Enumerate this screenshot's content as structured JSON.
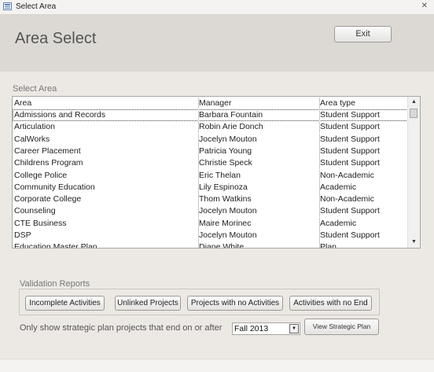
{
  "window": {
    "title": "Select Area",
    "close_glyph": "✕"
  },
  "header": {
    "title": "Area Select",
    "exit_label": "Exit"
  },
  "list": {
    "section_label": "Select Area",
    "columns": [
      "Area",
      "Manager",
      "Area type"
    ],
    "rows": [
      [
        "Admissions and Records",
        "Barbara Fountain",
        "Student Support"
      ],
      [
        "Articulation",
        "Robin Arie Donch",
        "Student Support"
      ],
      [
        "CalWorks",
        "Jocelyn Mouton",
        "Student Support"
      ],
      [
        "Career Placement",
        "Patricia Young",
        "Student Support"
      ],
      [
        "Childrens Program",
        "Christie Speck",
        "Student Support"
      ],
      [
        "College Police",
        "Eric Thelan",
        "Non-Academic"
      ],
      [
        "Community Education",
        "Lily Espinoza",
        "Academic"
      ],
      [
        "Corporate College",
        "Thom Watkins",
        "Non-Academic"
      ],
      [
        "Counseling",
        "Jocelyn Mouton",
        "Student Support"
      ],
      [
        "CTE Business",
        "Maire Morinec",
        "Academic"
      ],
      [
        "DSP",
        "Jocelyn Mouton",
        "Student Support"
      ],
      [
        "Education Master Plan",
        "Diane White",
        "Plan"
      ]
    ]
  },
  "validation": {
    "label": "Validation Reports",
    "buttons": {
      "incomplete": "Incomplete Activities",
      "unlinked": "Unlinked Projects",
      "no_activities": "Projects with no Activities",
      "no_end": "Activities with no End"
    }
  },
  "filter": {
    "label": "Only show strategic plan projects that end on or after",
    "selected": "Fall 2013",
    "view_label": "View Strategic Plan"
  },
  "icons": {
    "app": "form-icon",
    "scroll_up": "▲",
    "scroll_down": "▼",
    "combo_arrow": "▼"
  }
}
